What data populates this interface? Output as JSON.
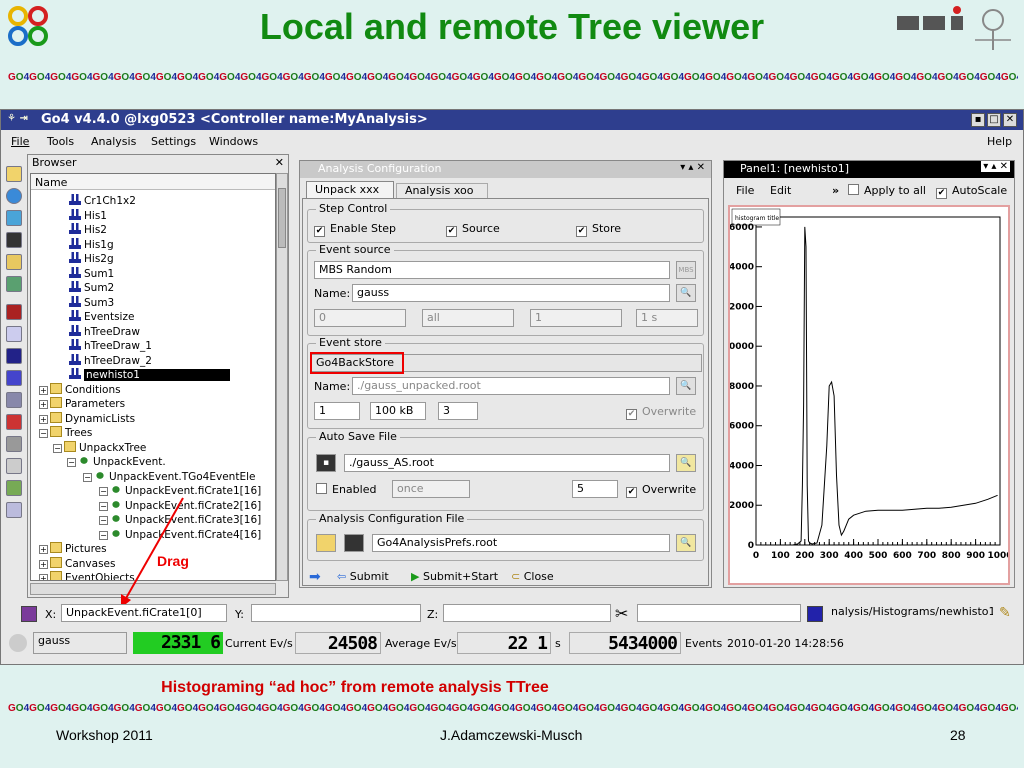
{
  "slide": {
    "title": "Local and remote Tree viewer",
    "banner_unit": "GO4",
    "caption": "Histograming “ad hoc” from remote analysis TTree",
    "footer_left": "Workshop 2011",
    "footer_center": "J.Adamczewski-Musch",
    "footer_page": "28",
    "drag_label": "Drag",
    "accent_color": "#118a11",
    "caption_color": "#d10000"
  },
  "window": {
    "title": "Go4 v4.4.0 @lxg0523 <Controller name:MyAnalysis>",
    "menu": [
      "File",
      "Tools",
      "Analysis",
      "Settings",
      "Windows"
    ],
    "help": "Help"
  },
  "browser": {
    "title": "Browser",
    "column": "Name",
    "items": [
      {
        "label": "Cr1Ch1x2",
        "icon": "histogram-icon"
      },
      {
        "label": "His1",
        "icon": "histogram-icon"
      },
      {
        "label": "His2",
        "icon": "histogram-icon"
      },
      {
        "label": "His1g",
        "icon": "histogram-icon"
      },
      {
        "label": "His2g",
        "icon": "histogram-icon"
      },
      {
        "label": "Sum1",
        "icon": "histogram-icon"
      },
      {
        "label": "Sum2",
        "icon": "histogram-icon"
      },
      {
        "label": "Sum3",
        "icon": "histogram-icon"
      },
      {
        "label": "Eventsize",
        "icon": "histogram-icon"
      },
      {
        "label": "hTreeDraw",
        "icon": "histogram-icon"
      },
      {
        "label": "hTreeDraw_1",
        "icon": "histogram-icon"
      },
      {
        "label": "hTreeDraw_2",
        "icon": "histogram-icon"
      },
      {
        "label": "newhisto1",
        "icon": "histogram-icon"
      },
      {
        "label": "Conditions",
        "icon": "folder-icon"
      },
      {
        "label": "Parameters",
        "icon": "folder-icon"
      },
      {
        "label": "DynamicLists",
        "icon": "folder-icon"
      },
      {
        "label": "Trees",
        "icon": "folder-icon"
      },
      {
        "label": "UnpackxTree",
        "icon": "tree-icon"
      },
      {
        "label": "UnpackEvent.",
        "icon": "branch-icon"
      },
      {
        "label": "UnpackEvent.TGo4EventEle",
        "icon": "branch-icon"
      },
      {
        "label": "UnpackEvent.fiCrate1[16]",
        "icon": "leaf-icon"
      },
      {
        "label": "UnpackEvent.fiCrate2[16]",
        "icon": "leaf-icon"
      },
      {
        "label": "UnpackEvent.fiCrate3[16]",
        "icon": "leaf-icon"
      },
      {
        "label": "UnpackEvent.fiCrate4[16]",
        "icon": "leaf-icon"
      },
      {
        "label": "Pictures",
        "icon": "folder-icon"
      },
      {
        "label": "Canvases",
        "icon": "folder-icon"
      },
      {
        "label": "EventObjects",
        "icon": "folder-icon"
      }
    ]
  },
  "config": {
    "title": "Analysis Configuration",
    "tabs": [
      "Unpack xxx",
      "Analysis xoo"
    ],
    "step_control": {
      "title": "Step Control",
      "enable": "Enable Step",
      "source": "Source",
      "store": "Store"
    },
    "event_source": {
      "title": "Event source",
      "type": "MBS Random",
      "name_label": "Name:",
      "name": "gauss",
      "v1": "0",
      "v2": "all",
      "v3": "1",
      "v4": "1 s"
    },
    "event_store": {
      "title": "Event store",
      "type": "Go4BackStore",
      "name_label": "Name:",
      "name": "./gauss_unpacked.root",
      "v1": "1",
      "v2": "100 kB",
      "v3": "3",
      "overwrite": "Overwrite"
    },
    "autosave": {
      "title": "Auto Save File",
      "file": "./gauss_AS.root",
      "enabled": "Enabled",
      "mode": "once",
      "value": "5",
      "overwrite": "Overwrite"
    },
    "config_file": {
      "title": "Analysis Configuration File",
      "file": "Go4AnalysisPrefs.root"
    },
    "buttons": {
      "submit": "Submit",
      "submit_start": "Submit+Start",
      "close": "Close"
    }
  },
  "panel": {
    "title": "Panel1: [newhisto1]",
    "menu_file": "File",
    "menu_edit": "Edit",
    "more": "»",
    "apply_all": "Apply to all",
    "autoscale": "AutoScale",
    "hist_title": "histogram title"
  },
  "coords": {
    "x_label": "X:",
    "x_value": "UnpackEvent.fiCrate1[0]",
    "y_label": "Y:",
    "z_label": "Z:",
    "path": "nalysis/Histograms/newhisto1"
  },
  "status": {
    "name": "gauss",
    "current_rate": "2331 6",
    "current_label": "Current Ev/s",
    "avg_rate": "24508",
    "avg_label": "Average Ev/s",
    "seconds": "22 1",
    "seconds_unit": "s",
    "events": "5434000",
    "events_label": "Events",
    "datetime": "2010-01-20 14:28:56"
  },
  "chart_data": {
    "type": "line",
    "title": "histogram title",
    "xlabel": "",
    "ylabel": "",
    "xlim": [
      0,
      1000
    ],
    "ylim": [
      0,
      10000
    ],
    "x_ticks": [
      "0",
      "100",
      "200",
      "300",
      "400",
      "500",
      "600",
      "700",
      "800",
      "900",
      "1000"
    ],
    "y_ticks": [
      "0",
      "2000",
      "4000",
      "6000",
      "8000",
      "0000",
      "2000",
      "4000",
      "6000"
    ],
    "series": [
      {
        "x": [
          0,
          150,
          170,
          185,
          190,
          195,
          200,
          205,
          210,
          215,
          220,
          230,
          250,
          270,
          290,
          300,
          310,
          320,
          330,
          340,
          350,
          360,
          370,
          380,
          400,
          450,
          500,
          550,
          600,
          650,
          700,
          750,
          800,
          850,
          900,
          950,
          990
        ],
        "y": [
          0,
          0,
          50,
          200,
          3000,
          7000,
          16000,
          15000,
          3000,
          200,
          100,
          50,
          100,
          1000,
          5000,
          8000,
          8200,
          7500,
          3500,
          1000,
          500,
          700,
          1000,
          1300,
          1500,
          1700,
          1750,
          1750,
          1750,
          1800,
          1850,
          1850,
          1900,
          2000,
          2100,
          2300,
          2500
        ]
      }
    ]
  }
}
